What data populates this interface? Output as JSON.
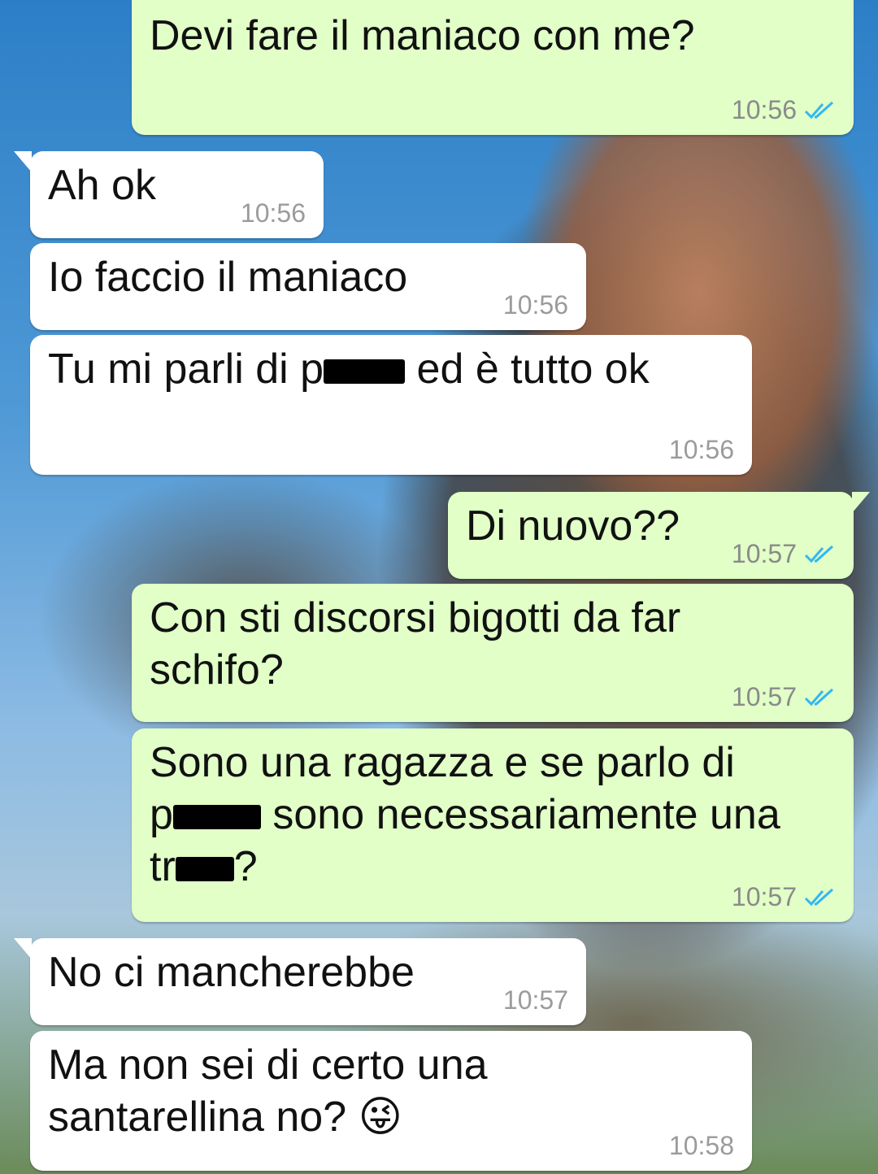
{
  "colors": {
    "outgoing_bubble": "#e1ffc7",
    "incoming_bubble": "#ffffff",
    "read_ticks": "#34b7f1",
    "time_text": "#8a8a8a"
  },
  "messages": [
    {
      "direction": "outgoing",
      "text": "Devi fare il maniaco con me?",
      "time": "10:56",
      "status_icon": "double-check-read-icon"
    },
    {
      "direction": "incoming",
      "text": "Ah ok",
      "time": "10:56"
    },
    {
      "direction": "incoming",
      "text": "Io faccio il maniaco",
      "time": "10:56"
    },
    {
      "direction": "incoming",
      "text_parts": [
        "Tu mi parli di p",
        " ed è tutto ok"
      ],
      "time": "10:56"
    },
    {
      "direction": "outgoing",
      "text": "Di nuovo??",
      "time": "10:57",
      "status_icon": "double-check-read-icon"
    },
    {
      "direction": "outgoing",
      "text": "Con sti discorsi bigotti da far\nschifo?",
      "time": "10:57",
      "status_icon": "double-check-read-icon"
    },
    {
      "direction": "outgoing",
      "text_parts": [
        "Sono una ragazza e se parlo di\np",
        " sono necessariamente una\ntr",
        "?"
      ],
      "time": "10:57",
      "status_icon": "double-check-read-icon"
    },
    {
      "direction": "incoming",
      "text": "No ci mancherebbe",
      "time": "10:57"
    },
    {
      "direction": "incoming",
      "text": "Ma non sei di certo una\nsantarellina no? 😜",
      "time": "10:58"
    }
  ]
}
